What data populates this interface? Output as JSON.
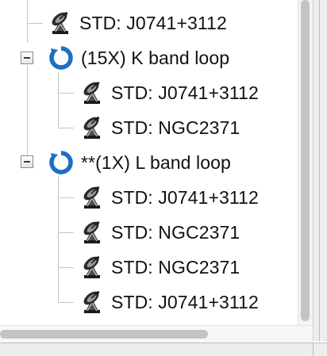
{
  "tree": {
    "items": [
      {
        "type": "standard",
        "label": "STD: J0741+3112"
      },
      {
        "type": "loop",
        "label": "(15X) K band loop",
        "expanded": true
      },
      {
        "type": "standard",
        "label": "STD: J0741+3112"
      },
      {
        "type": "standard",
        "label": "STD: NGC2371"
      },
      {
        "type": "loop",
        "label": "**(1X) L band loop",
        "expanded": true
      },
      {
        "type": "standard",
        "label": "STD: J0741+3112"
      },
      {
        "type": "standard",
        "label": "STD: NGC2371"
      },
      {
        "type": "standard",
        "label": "STD: NGC2371"
      },
      {
        "type": "standard",
        "label": "STD: J0741+3112"
      }
    ]
  },
  "icons": {
    "standard": "telescope-icon",
    "loop": "loop-icon",
    "toggle": "collapse-minus-icon"
  },
  "colors": {
    "loop_icon": "#1b6fc4",
    "tree_lines": "#c6c6c6"
  }
}
